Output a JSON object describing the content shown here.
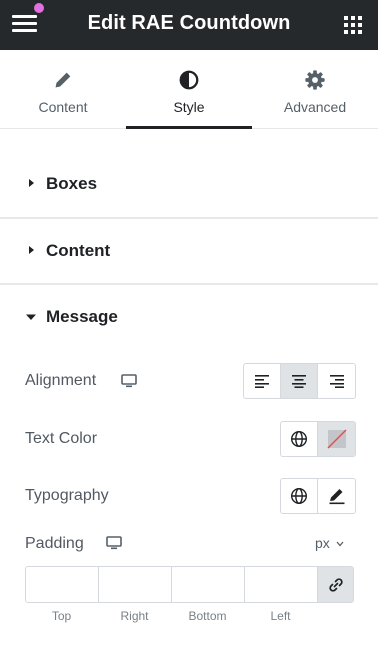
{
  "header": {
    "title": "Edit RAE Countdown",
    "menu_icon": "hamburger-icon",
    "apps_icon": "grid-icon",
    "notification_color": "#e46fe0"
  },
  "tabs": [
    {
      "label": "Content",
      "icon": "pencil-icon",
      "active": false
    },
    {
      "label": "Style",
      "icon": "half-circle-icon",
      "active": true
    },
    {
      "label": "Advanced",
      "icon": "gear-icon",
      "active": false
    }
  ],
  "sections": {
    "boxes": {
      "title": "Boxes",
      "expanded": false
    },
    "content": {
      "title": "Content",
      "expanded": false
    },
    "message": {
      "title": "Message",
      "expanded": true
    }
  },
  "message": {
    "alignment": {
      "label": "Alignment",
      "options": [
        "left",
        "center",
        "right"
      ],
      "selected": "center"
    },
    "text_color": {
      "label": "Text Color"
    },
    "typography": {
      "label": "Typography"
    },
    "padding": {
      "label": "Padding",
      "unit": "px",
      "fields": [
        {
          "label": "Top",
          "value": ""
        },
        {
          "label": "Right",
          "value": ""
        },
        {
          "label": "Bottom",
          "value": ""
        },
        {
          "label": "Left",
          "value": ""
        }
      ]
    }
  }
}
